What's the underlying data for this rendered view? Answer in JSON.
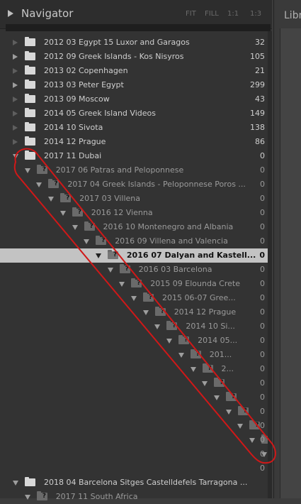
{
  "navigator": {
    "title": "Navigator",
    "zoom": [
      "FIT",
      "FILL",
      "1:1",
      "1:3"
    ]
  },
  "right_panel": {
    "label": "Libr"
  },
  "folders": [
    {
      "name": "2012 03 Egypt 15 Luxor and Garagos",
      "count": "32",
      "expander": "none",
      "missing": false,
      "sel": false
    },
    {
      "name": "2012 09 Greek Islands - Kos Nisyros",
      "count": "105",
      "expander": "right",
      "missing": false,
      "sel": false
    },
    {
      "name": "2013 02 Copenhagen",
      "count": "21",
      "expander": "none",
      "missing": false,
      "sel": false
    },
    {
      "name": "2013 03 Peter Egypt",
      "count": "299",
      "expander": "right",
      "missing": false,
      "sel": false
    },
    {
      "name": "2013 09 Moscow",
      "count": "43",
      "expander": "none",
      "missing": false,
      "sel": false
    },
    {
      "name": "2014 05 Greek Island Videos",
      "count": "149",
      "expander": "none",
      "missing": false,
      "sel": false
    },
    {
      "name": "2014 10 Sivota",
      "count": "138",
      "expander": "none",
      "missing": false,
      "sel": false
    },
    {
      "name": "2014 12 Prague",
      "count": "86",
      "expander": "none",
      "missing": false,
      "sel": false
    },
    {
      "name": "2017 11 Dubai",
      "count": "0",
      "expander": "down",
      "missing": false,
      "sel": false
    },
    {
      "name": "2017 06 Patras and Peloponnese",
      "count": "0",
      "expander": "down",
      "missing": true,
      "sel": false
    },
    {
      "name": "2017 04 Greek Islands - Peloponnese Poros ...",
      "count": "0",
      "expander": "down",
      "missing": true,
      "sel": false
    },
    {
      "name": "2017 03 Villena",
      "count": "0",
      "expander": "down",
      "missing": true,
      "sel": false
    },
    {
      "name": "2016 12 Vienna",
      "count": "0",
      "expander": "down",
      "missing": true,
      "sel": false
    },
    {
      "name": "2016 10 Montenegro and Albania",
      "count": "0",
      "expander": "down",
      "missing": true,
      "sel": false
    },
    {
      "name": "2016 09 Villena and Valencia",
      "count": "0",
      "expander": "down",
      "missing": true,
      "sel": false
    },
    {
      "name": "2016 07 Dalyan and Kastell...",
      "count": "0",
      "expander": "down",
      "missing": true,
      "sel": true
    },
    {
      "name": "2016 03 Barcelona",
      "count": "0",
      "expander": "down",
      "missing": true,
      "sel": false
    },
    {
      "name": "2015 09 Elounda Crete",
      "count": "0",
      "expander": "down",
      "missing": true,
      "sel": false
    },
    {
      "name": "2015  06-07 Gree...",
      "count": "0",
      "expander": "down",
      "missing": true,
      "sel": false
    },
    {
      "name": "2014 12 Prague",
      "count": "0",
      "expander": "down",
      "missing": true,
      "sel": false
    },
    {
      "name": "2014 10 Si...",
      "count": "0",
      "expander": "down",
      "missing": true,
      "sel": false
    },
    {
      "name": "2014 05...",
      "count": "0",
      "expander": "down",
      "missing": true,
      "sel": false
    },
    {
      "name": "201...",
      "count": "0",
      "expander": "down",
      "missing": true,
      "sel": false
    },
    {
      "name": "2...",
      "count": "0",
      "expander": "down",
      "missing": true,
      "sel": false
    },
    {
      "name": "",
      "count": "0",
      "expander": "down",
      "missing": true,
      "sel": false
    },
    {
      "name": "",
      "count": "0",
      "expander": "down",
      "missing": true,
      "sel": false
    },
    {
      "name": "",
      "count": "0",
      "expander": "down",
      "missing": true,
      "sel": false
    },
    {
      "name": "",
      "count": "0",
      "expander": "down",
      "missing": true,
      "sel": false
    },
    {
      "name": "",
      "count": "0",
      "expander": "down",
      "missing": true,
      "sel": false
    },
    {
      "name": "",
      "count": "0",
      "expander": "down",
      "missing": true,
      "sel": false
    },
    {
      "name": "",
      "count": "0",
      "expander": "none",
      "missing": true,
      "sel": false
    },
    {
      "name": "2018 04 Barcelona Sitges Castelldefels Tarragona ...",
      "count": "",
      "expander": "down",
      "missing": false,
      "sel": false
    },
    {
      "name": "2017 11 South Africa",
      "count": "",
      "expander": "down",
      "missing": true,
      "sel": false
    }
  ],
  "colors": {
    "annotation": "#d01818",
    "selection": "#c3c3c3"
  }
}
